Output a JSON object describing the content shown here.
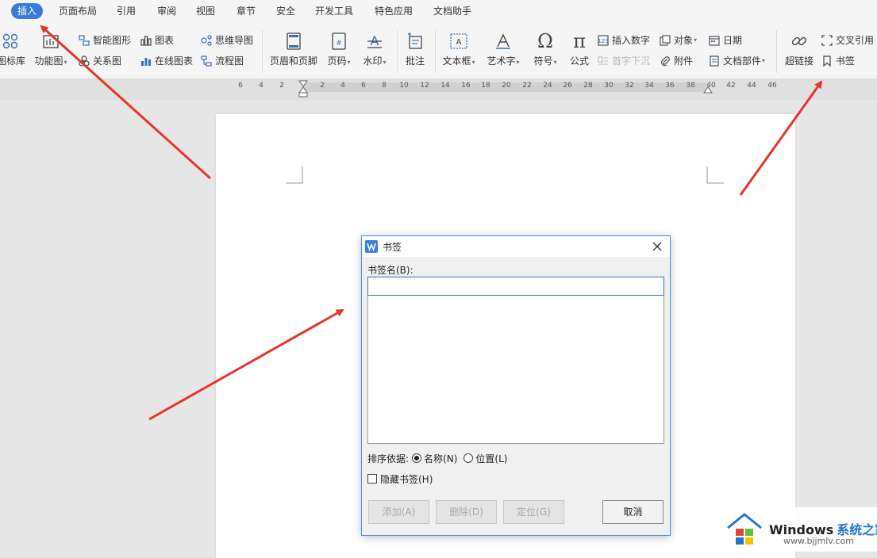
{
  "menu": {
    "tabs": [
      "插入",
      "页面布局",
      "引用",
      "审阅",
      "视图",
      "章节",
      "安全",
      "开发工具",
      "特色应用",
      "文档助手"
    ]
  },
  "ribbon": {
    "icon_lib": "图标库",
    "func_chart": "功能图",
    "smart_shape": "智能图形",
    "chart": "图表",
    "mind_map": "思维导图",
    "relation_chart": "关系图",
    "online_chart": "在线图表",
    "flow_chart": "流程图",
    "header_footer": "页眉和页脚",
    "page_number": "页码",
    "watermark": "水印",
    "comment": "批注",
    "text_box": "文本框",
    "word_art": "艺术字",
    "symbol": "符号",
    "formula": "公式",
    "insert_number": "插入数字",
    "drop_cap": "首字下沉",
    "object": "对象",
    "attachment": "附件",
    "date": "日期",
    "doc_parts": "文档部件",
    "hyperlink": "超链接",
    "cross_ref": "交叉引用",
    "bookmark": "书签"
  },
  "ruler": {
    "ticks": [
      "6",
      "4",
      "2",
      "2",
      "4",
      "6",
      "8",
      "10",
      "12",
      "14",
      "16",
      "18",
      "20",
      "22",
      "24",
      "26",
      "28",
      "30",
      "32",
      "34",
      "36",
      "38",
      "40",
      "42",
      "44",
      "46"
    ]
  },
  "dialog": {
    "title": "书签",
    "name_label": "书签名(B):",
    "name_value": "",
    "sort_label": "排序依据:",
    "sort_name": "名称(N)",
    "sort_position": "位置(L)",
    "hide_label": "隐藏书签(H)",
    "add_button": "添加(A)",
    "delete_button": "删除(D)",
    "goto_button": "定位(G)",
    "cancel_button": "取消"
  },
  "watermark": {
    "brand": "Windows",
    "brand_cn": "系统之家",
    "url": "www.bjjmlv.com"
  },
  "colors": {
    "active_tab": "#3a7bd5",
    "arrow": "#e8342c",
    "dialog_border": "#4a90d9"
  }
}
